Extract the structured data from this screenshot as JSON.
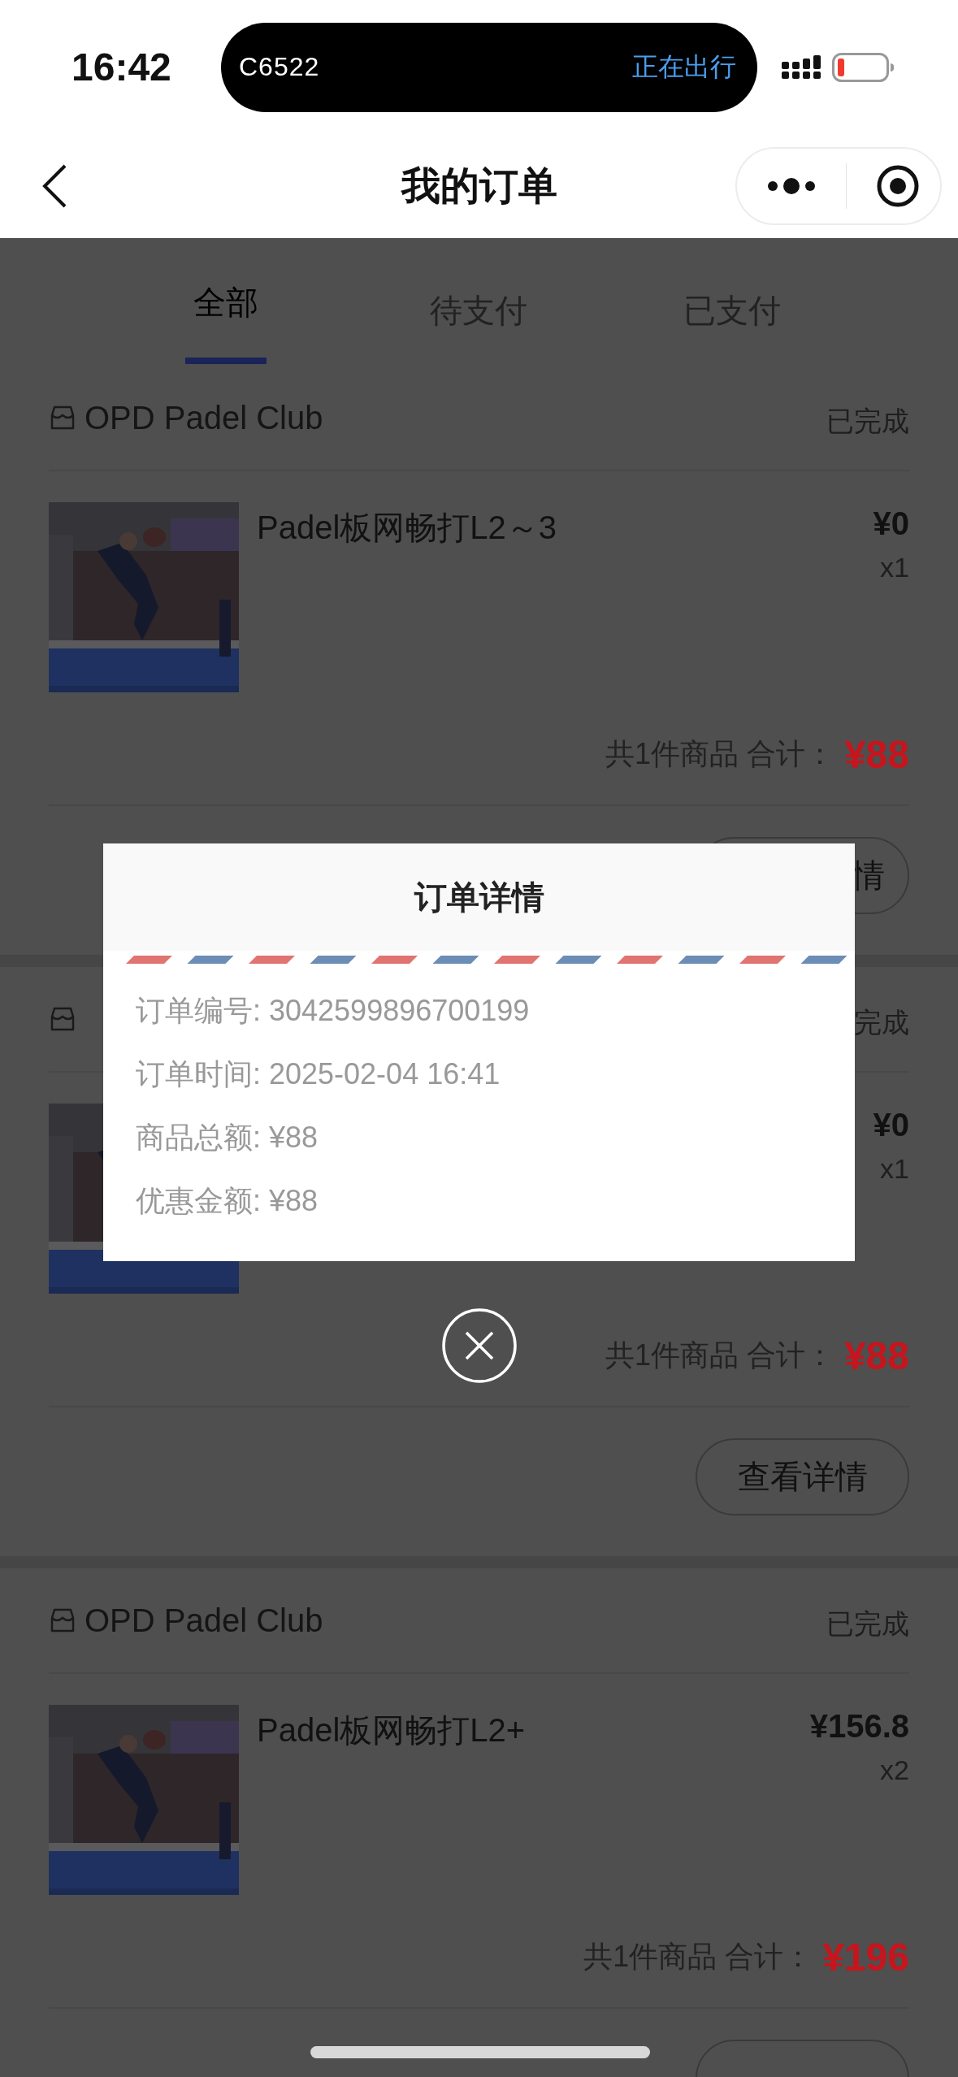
{
  "status_bar": {
    "time": "16:42",
    "island": {
      "code": "C6522",
      "status": "正在出行"
    }
  },
  "nav": {
    "title": "我的订单"
  },
  "tabs": [
    {
      "label": "全部",
      "selected": true
    },
    {
      "label": "待支付",
      "selected": false
    },
    {
      "label": "已支付",
      "selected": false
    }
  ],
  "orders": [
    {
      "shop": "OPD Padel Club",
      "status": "已完成",
      "title": "Padel板网畅打L2～3",
      "price": "¥0",
      "quantity": "x1",
      "summary": "共1件商品 合计：",
      "total": "¥88",
      "button": "情"
    },
    {
      "status": "完成",
      "price": "¥0",
      "quantity": "x1",
      "summary": "共1件商品 合计：",
      "total": "¥88",
      "button": "查看详情"
    },
    {
      "shop": "OPD Padel Club",
      "status": "已完成",
      "title": "Padel板网畅打L2+",
      "price": "¥156.8",
      "quantity": "x2",
      "summary": "共1件商品 合计：",
      "total": "¥196",
      "button_shown": true
    }
  ],
  "modal": {
    "title": "订单详情",
    "rows": [
      "订单编号: 3042599896700199",
      "订单时间: 2025-02-04 16:41",
      "商品总额: ¥88",
      "优惠金额: ¥88"
    ]
  }
}
